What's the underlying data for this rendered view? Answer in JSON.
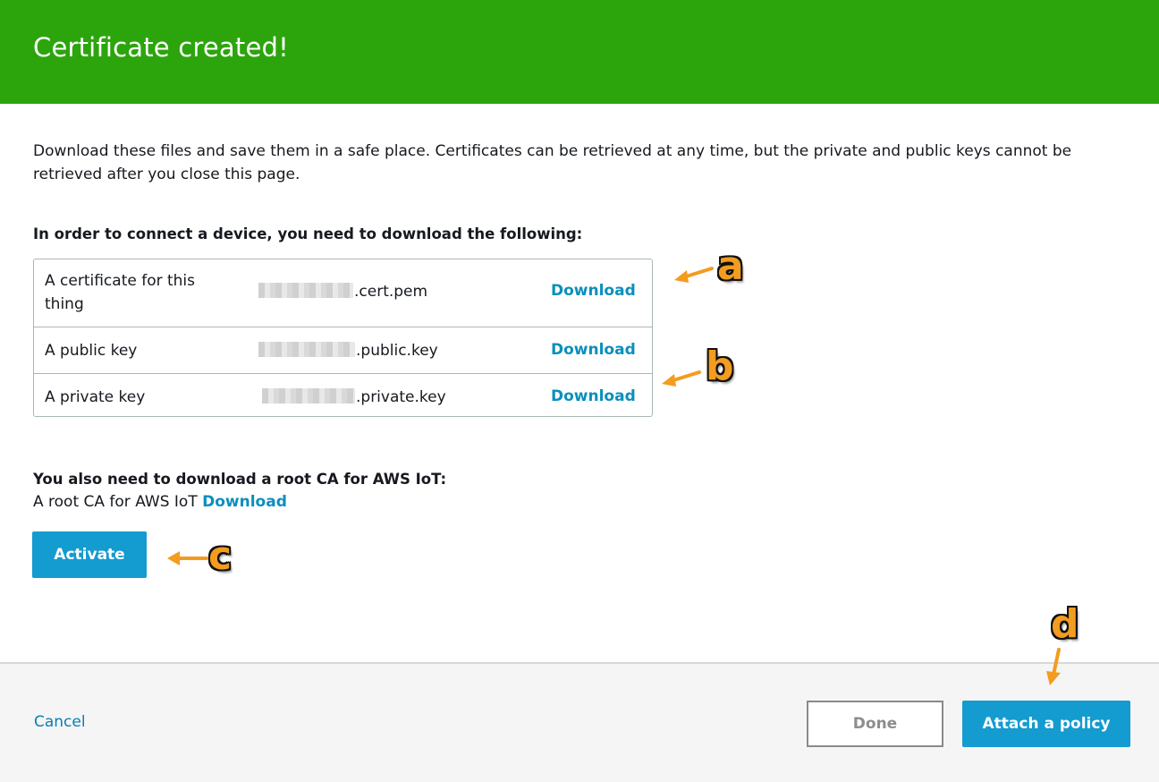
{
  "header": {
    "title": "Certificate created!"
  },
  "intro": "Download these files and save them in a safe place. Certificates can be retrieved at any time, but the private and public keys cannot be retrieved after you close this page.",
  "files_heading": "In order to connect a device, you need to download the following:",
  "files": [
    {
      "label": "A certificate for this thing",
      "filename_suffix": ".cert.pem",
      "action": "Download"
    },
    {
      "label": "A public key",
      "filename_suffix": ".public.key",
      "action": "Download"
    },
    {
      "label": "A private key",
      "filename_suffix": ".private.key",
      "action": "Download"
    }
  ],
  "root_ca": {
    "heading": "You also need to download a root CA for AWS IoT:",
    "label": "A root CA for AWS IoT",
    "action": "Download"
  },
  "activate_label": "Activate",
  "footer": {
    "cancel_label": "Cancel",
    "done_label": "Done",
    "attach_policy_label": "Attach a policy"
  },
  "annotations": {
    "a": "a",
    "b": "b",
    "c": "c",
    "d": "d"
  },
  "colors": {
    "header_bg": "#2ca50d",
    "link": "#0a8fbd",
    "primary_button": "#149bd0",
    "annotation": "#f39c1f"
  }
}
